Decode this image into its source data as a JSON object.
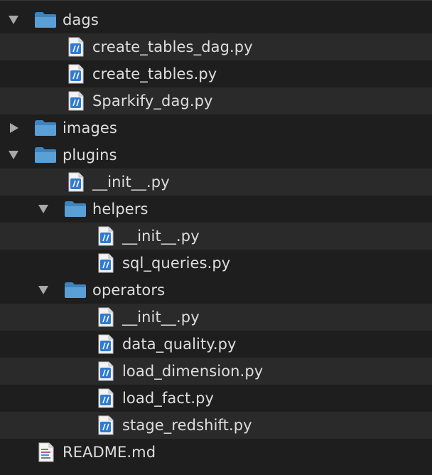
{
  "colors": {
    "background": "#1e1e1e",
    "row_alt": "#2a2a2a",
    "text": "#dedede",
    "folder": "#5aa0d6",
    "python_badge": "#2f7bd1"
  },
  "tree": [
    {
      "label": "dags",
      "kind": "folder",
      "state": "expanded",
      "icon": "folder-icon"
    },
    {
      "label": "create_tables_dag.py",
      "kind": "file",
      "icon": "python-file-icon"
    },
    {
      "label": "create_tables.py",
      "kind": "file",
      "icon": "python-file-icon"
    },
    {
      "label": "Sparkify_dag.py",
      "kind": "file",
      "icon": "python-file-icon"
    },
    {
      "label": "images",
      "kind": "folder",
      "state": "collapsed",
      "icon": "folder-icon"
    },
    {
      "label": "plugins",
      "kind": "folder",
      "state": "expanded",
      "icon": "folder-icon"
    },
    {
      "label": "__init__.py",
      "kind": "file",
      "icon": "python-file-icon"
    },
    {
      "label": "helpers",
      "kind": "folder",
      "state": "expanded",
      "icon": "folder-icon"
    },
    {
      "label": "__init__.py",
      "kind": "file",
      "icon": "python-file-icon"
    },
    {
      "label": "sql_queries.py",
      "kind": "file",
      "icon": "python-file-icon"
    },
    {
      "label": "operators",
      "kind": "folder",
      "state": "expanded",
      "icon": "folder-icon"
    },
    {
      "label": "__init__.py",
      "kind": "file",
      "icon": "python-file-icon"
    },
    {
      "label": "data_quality.py",
      "kind": "file",
      "icon": "python-file-icon"
    },
    {
      "label": "load_dimension.py",
      "kind": "file",
      "icon": "python-file-icon"
    },
    {
      "label": "load_fact.py",
      "kind": "file",
      "icon": "python-file-icon"
    },
    {
      "label": "stage_redshift.py",
      "kind": "file",
      "icon": "python-file-icon"
    },
    {
      "label": "README.md",
      "kind": "file",
      "icon": "markdown-file-icon"
    }
  ]
}
